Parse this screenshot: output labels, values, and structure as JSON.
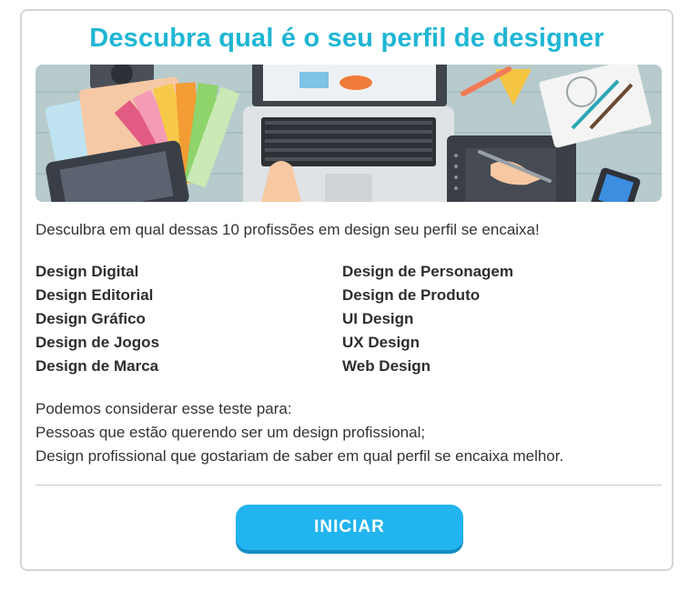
{
  "title": "Descubra qual é o seu perfil de designer",
  "intro": "Desculbra em qual dessas 10 profissões em design seu perfil se encaixa!",
  "professions_left": [
    "Design Digital",
    "Design Editorial",
    "Design Gráfico",
    "Design de Jogos",
    "Design de Marca"
  ],
  "professions_right": [
    "Design de Personagem",
    "Design de Produto",
    "UI Design",
    "UX Design",
    "Web Design"
  ],
  "notes": [
    "Podemos considerar esse teste para:",
    "Pessoas que estão querendo ser um design profissional;",
    "Design profissional que gostariam de saber em qual perfil se encaixa melhor."
  ],
  "button": {
    "label": "INICIAR"
  },
  "colors": {
    "title": "#1fb6d4",
    "button": "#22b4ee",
    "button_shadow": "#138fc6",
    "border": "#d6d6d6"
  },
  "banner": {
    "illustration": "designer-desk-illustration"
  }
}
